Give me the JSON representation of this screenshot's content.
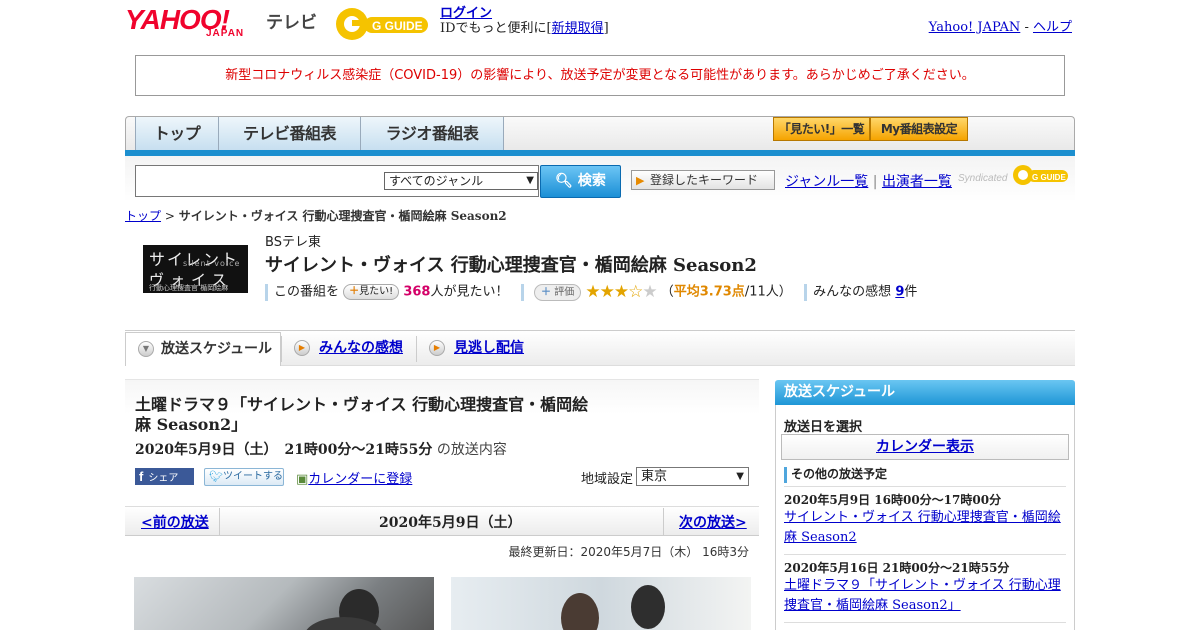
{
  "header": {
    "yahoo_logo": "YAHOO!",
    "japan_logo": "JAPAN",
    "tv_label": "テレビ",
    "gguide_logo": "G GUIDE",
    "login_link": "ログイン",
    "id_text_prefix": "IDでもっと便利に[",
    "signup_link": "新規取得",
    "id_text_suffix": "]",
    "yahoo_japan_link": "Yahoo! JAPAN",
    "link_separator": "-",
    "help_link": "ヘルプ"
  },
  "notice": "新型コロナウィルス感染症（COVID-19）の影響により、放送予定が変更となる可能性があります。あらかじめご了承ください。",
  "nav": {
    "tabs": [
      "トップ",
      "テレビ番組表",
      "ラジオ番組表"
    ],
    "mitai_list": "「見たい!」一覧",
    "my_schedule": "My番組表設定"
  },
  "search": {
    "input_value": "",
    "genre_selected": "すべてのジャンル",
    "search_button": "検索",
    "keyword_button": "登録したキーワード",
    "genre_list_link": "ジャンル一覧",
    "links_separator": "|",
    "performer_list_link": "出演者一覧",
    "syndicated_text": "Syndicated",
    "syndicated_logo": "G GUIDE"
  },
  "breadcrumb": {
    "top": "トップ",
    "separator": ">",
    "current": "サイレント・ヴォイス 行動心理捜査官・楯岡絵麻 Season2"
  },
  "program": {
    "thumb_line1": "サイレント",
    "thumb_line2": "ヴォイス",
    "thumb_sub": "silent voice",
    "thumb_small": "行動心理捜査官 楯岡絵麻",
    "channel": "BSテレ東",
    "title": "サイレント・ヴォイス 行動心理捜査官・楯岡絵麻 Season2",
    "mitai_prefix": "この番組を",
    "mitai_badge": "見たい!",
    "mitai_count": "368",
    "mitai_suffix": "人が見たい！",
    "rating_badge": "評価",
    "rating_value": 3.73,
    "rating_avg_prefix": "（",
    "rating_avg": "平均3.73点",
    "rating_count": "/11人）",
    "reviews_prefix": "みんなの感想",
    "reviews_count": "9",
    "reviews_suffix": "件"
  },
  "tabs": {
    "schedule": "放送スケジュール",
    "reviews": "みんなの感想",
    "catchup": "見逃し配信"
  },
  "episode": {
    "title_line1": "土曜ドラマ９「サイレント・ヴォイス 行動心理捜査官・楯岡絵",
    "title_line2": "麻 Season2」",
    "date": "2020年5月9日（土）　21時00分～21時55分",
    "date_suffix": "の放送内容",
    "share_fb_logo": "f",
    "share_fb": "シェア",
    "share_tw": "ツイートする",
    "calendar_link": "カレンダーに登録",
    "region_label": "地域設定",
    "region_value": "東京"
  },
  "pager": {
    "prev": "<前の放送",
    "date": "2020年5月9日（土）",
    "next": "次の放送>"
  },
  "updated": "最終更新日：2020年5月7日（木） 16時3分",
  "sidebar": {
    "header": "放送スケジュール",
    "select_date": "放送日を選択",
    "calendar_button": "カレンダー表示",
    "other_label": "その他の放送予定",
    "items": [
      {
        "date": "2020年5月9日 16時00分～17時00分",
        "title": "サイレント・ヴォイス 行動心理捜査官・楯岡絵麻 Season2"
      },
      {
        "date": "2020年5月16日 21時00分～21時55分",
        "title": "土曜ドラマ９「サイレント・ヴォイス 行動心理捜査官・楯岡絵麻 Season2」"
      }
    ]
  },
  "colors": {
    "brand_red": "#f0032d",
    "nav_blue": "#1c8fcf",
    "link": "#0000cc",
    "accent_orange": "#f5a300",
    "pink": "#d40068"
  }
}
